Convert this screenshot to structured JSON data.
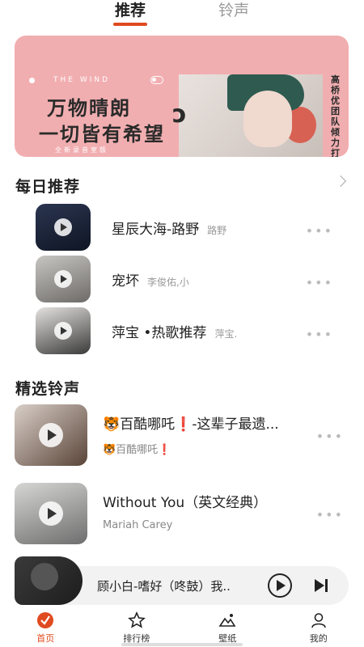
{
  "top_tabs": [
    "推荐",
    "铃声"
  ],
  "banner": {
    "tag": "THE WIND",
    "line1": "万物晴朗",
    "line2": "一切皆有希望",
    "line3": "全新录音室版",
    "vertical": "高桥优团队倾力打造"
  },
  "daily": {
    "title": "每日推荐",
    "items": [
      {
        "title": "星辰大海-路野",
        "artist": "路野"
      },
      {
        "title": "宠坏",
        "artist": "李俊佑,小"
      },
      {
        "title": "萍宝 •热歌推荐",
        "artist": "萍宝."
      }
    ]
  },
  "ringtones": {
    "title": "精选铃声",
    "items": [
      {
        "title": "🐯百酷哪吒❗-这辈子最遗...",
        "subtitle": "🐯百酷哪吒❗"
      },
      {
        "title": "Without You（英文经典）",
        "subtitle": "Mariah Carey"
      }
    ]
  },
  "player": {
    "title": "顾小白-嗜好（咚鼓）我.."
  },
  "nav": [
    "首页",
    "排行榜",
    "壁纸",
    "我的"
  ],
  "colors": {
    "accent": "#e04a1f",
    "banner": "#f1aeb0"
  }
}
